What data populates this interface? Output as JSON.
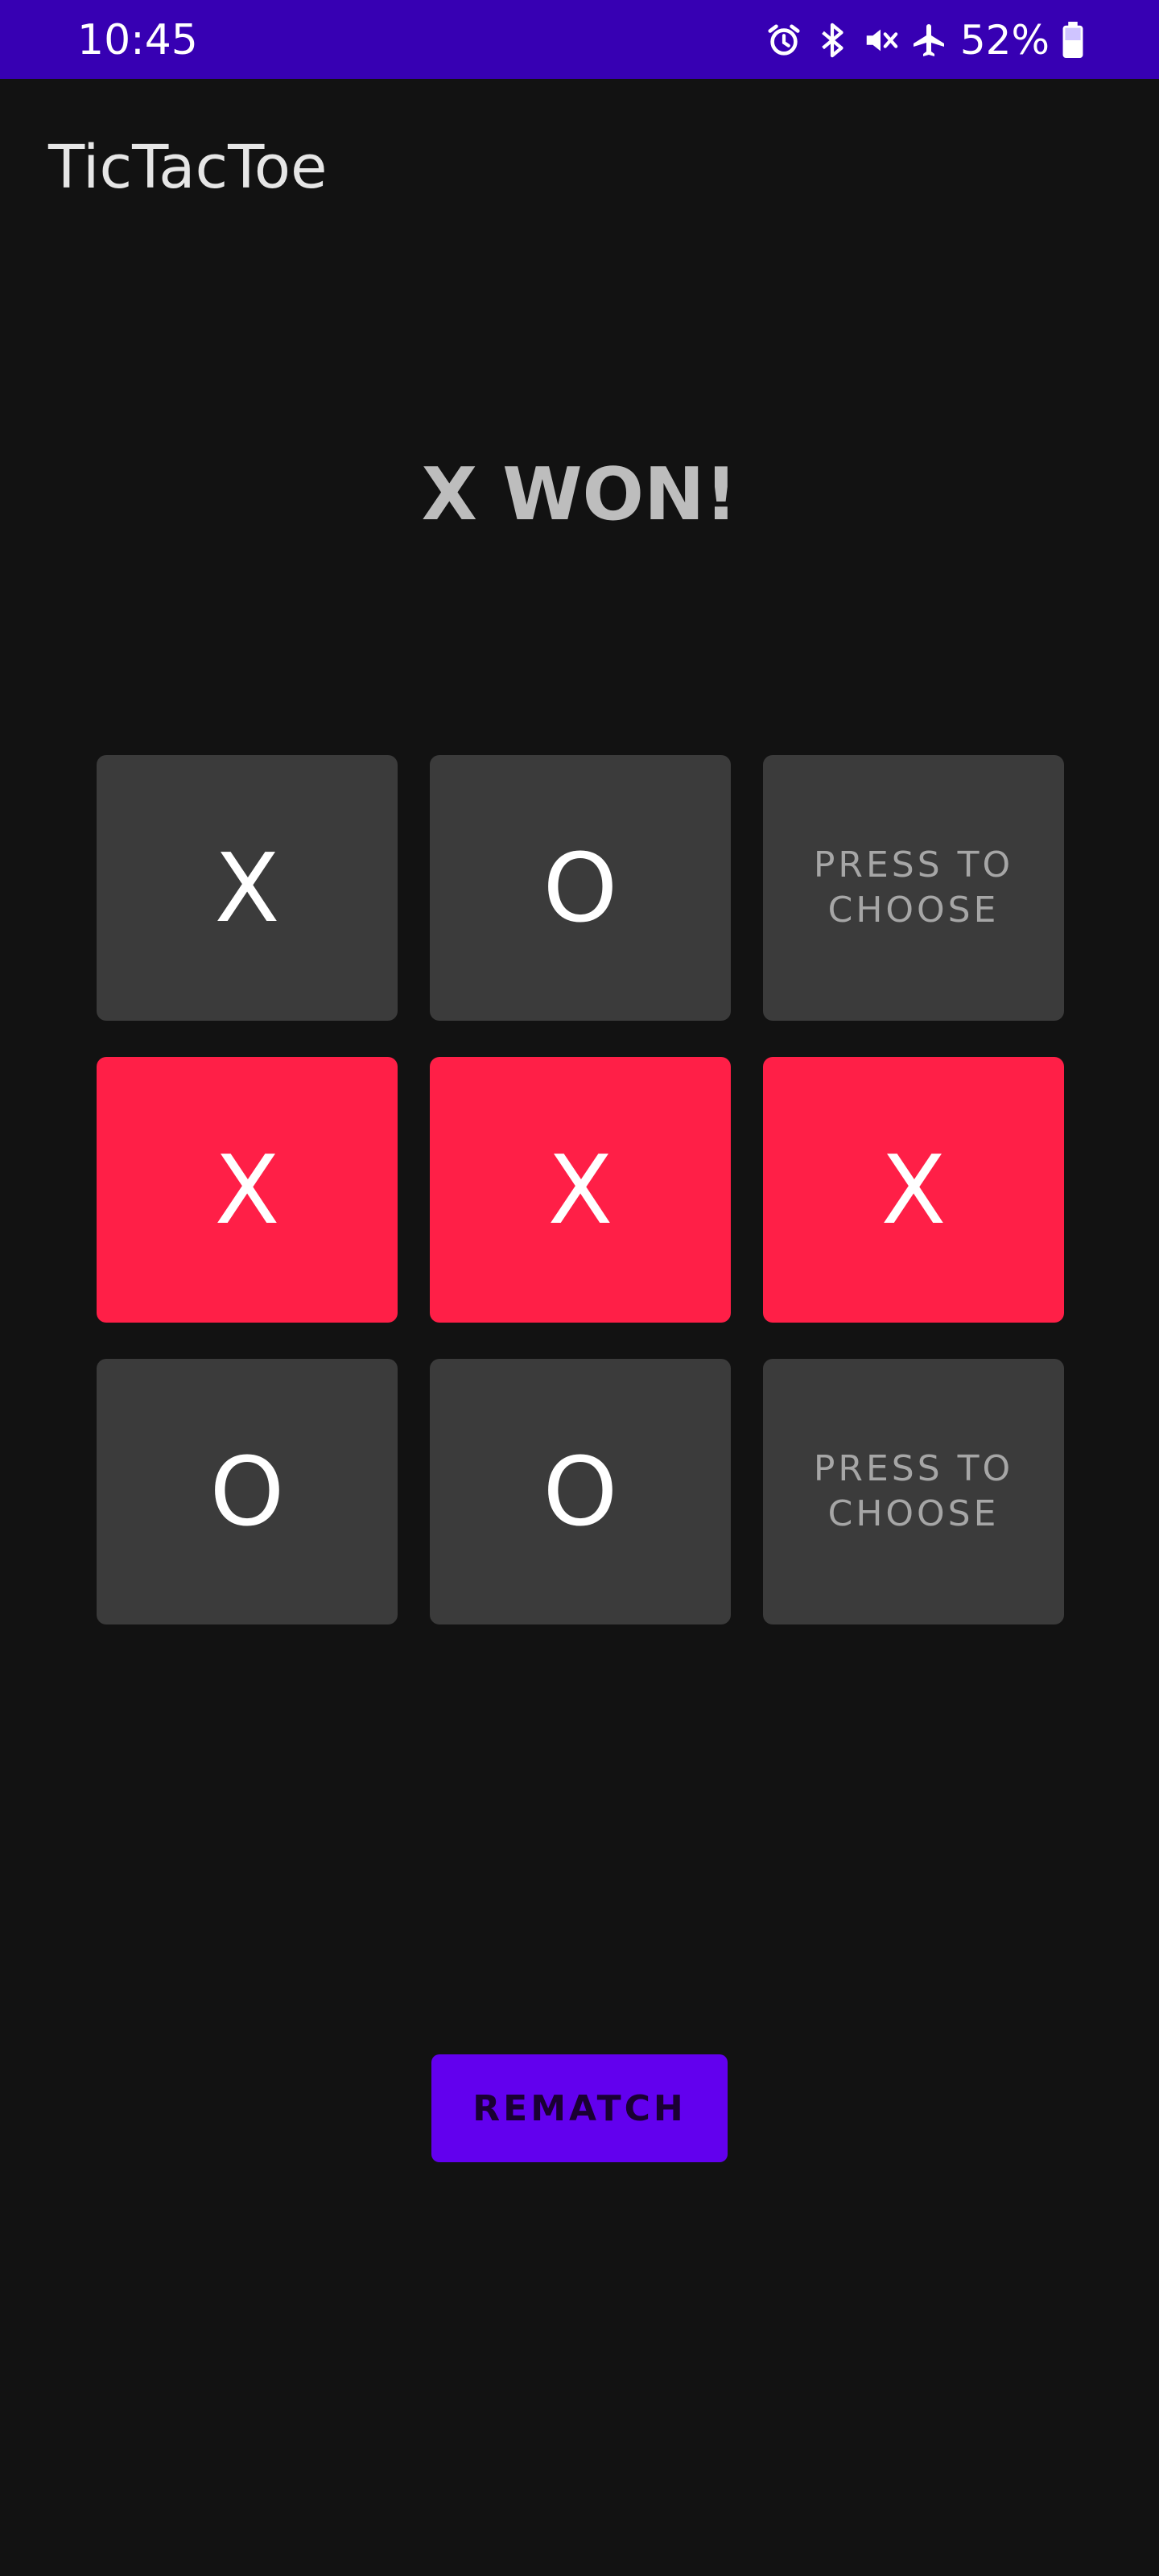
{
  "status_bar": {
    "time": "10:45",
    "battery_percent": "52%",
    "icons": [
      "alarm-icon",
      "bluetooth-icon",
      "mute-icon",
      "airplane-icon",
      "battery-icon"
    ],
    "background_color": "#3700B3"
  },
  "app_bar": {
    "title": "TicTacToe"
  },
  "game": {
    "status_text": "X WON!",
    "cells": [
      {
        "label": "X",
        "state": "filled"
      },
      {
        "label": "O",
        "state": "filled"
      },
      {
        "label": "PRESS TO CHOOSE",
        "state": "empty"
      },
      {
        "label": "X",
        "state": "winning"
      },
      {
        "label": "X",
        "state": "winning"
      },
      {
        "label": "X",
        "state": "winning"
      },
      {
        "label": "O",
        "state": "filled"
      },
      {
        "label": "O",
        "state": "filled"
      },
      {
        "label": "PRESS TO CHOOSE",
        "state": "empty"
      }
    ],
    "colors": {
      "cell": "#3b3b3b",
      "winning_cell": "#ff1f47"
    }
  },
  "actions": {
    "rematch_label": "REMATCH",
    "rematch_color": "#6200EE"
  }
}
